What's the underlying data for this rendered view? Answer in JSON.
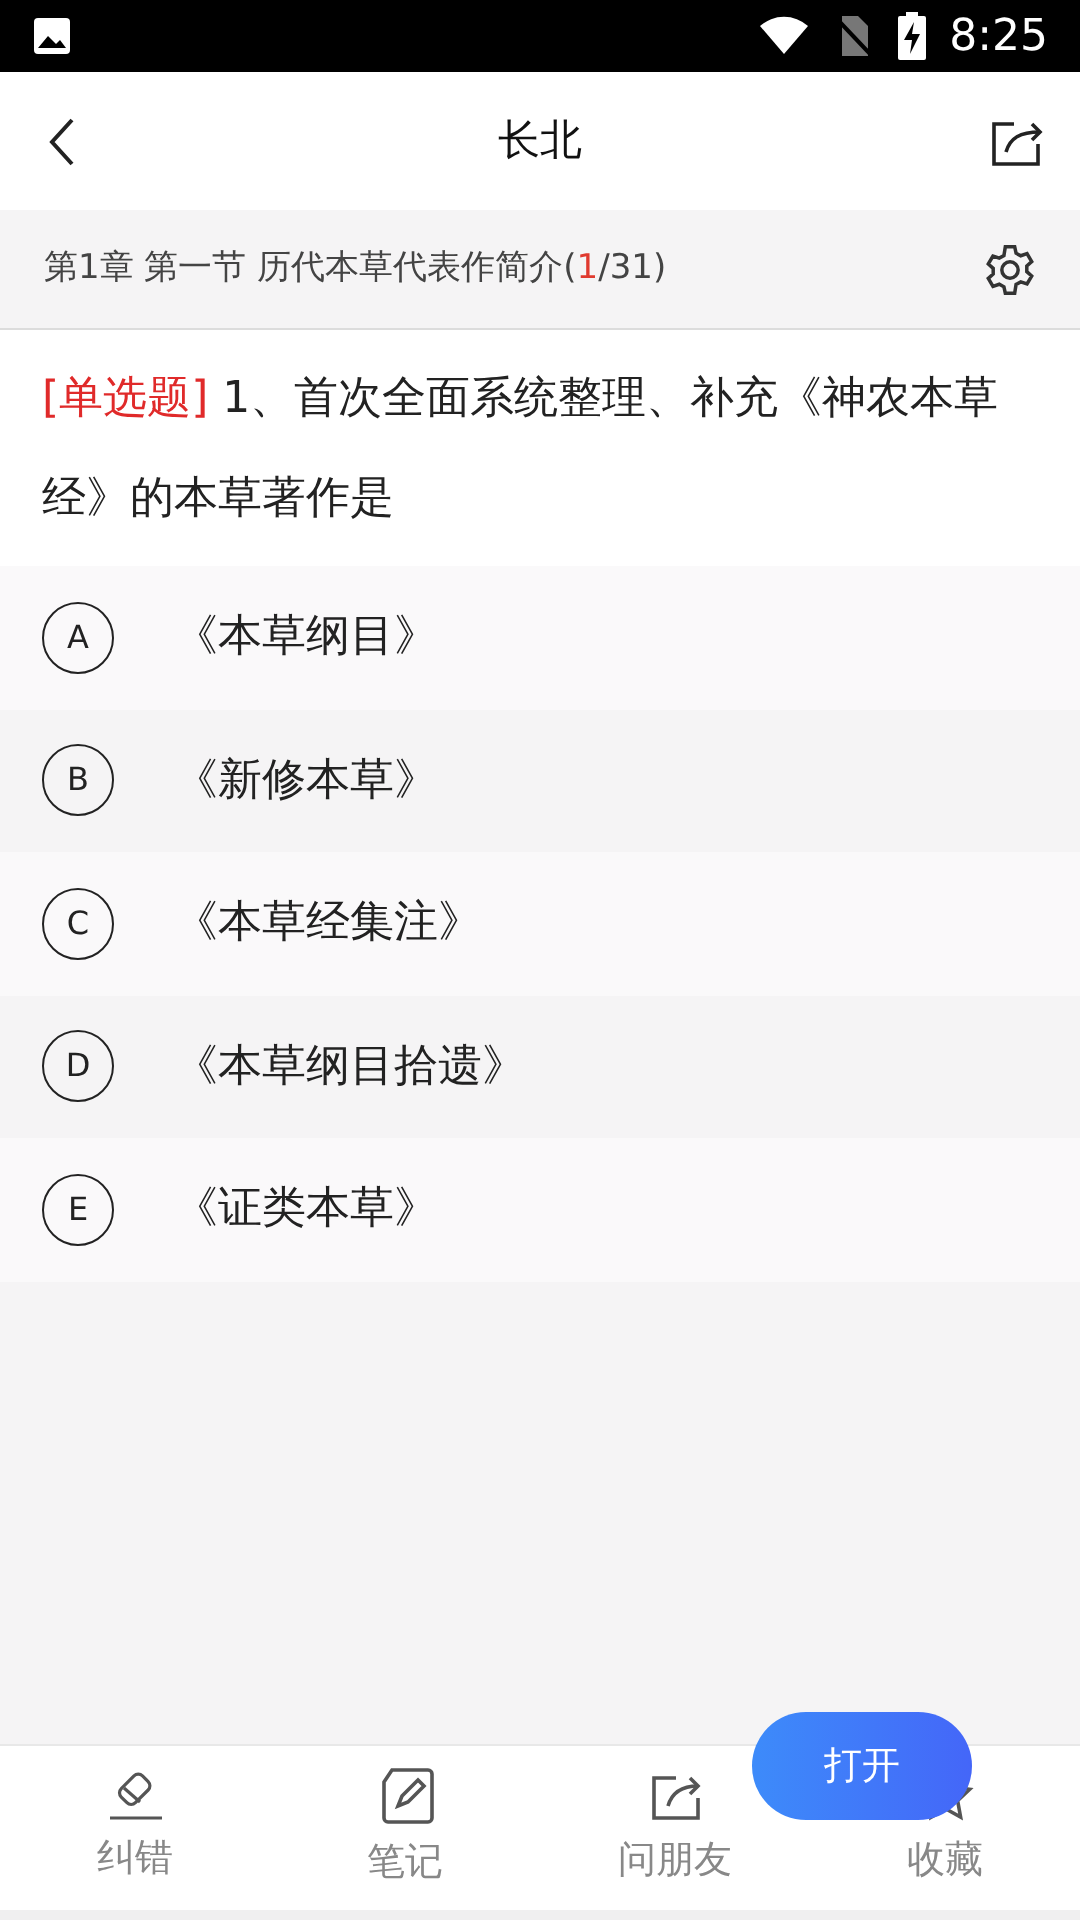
{
  "status_bar": {
    "time": "8:25"
  },
  "header": {
    "title": "长北"
  },
  "chapter": {
    "prefix": "第1章 第一节 历代本草代表作简介(",
    "current": "1",
    "suffix": "/31)"
  },
  "question": {
    "type": "[单选题]",
    "text": "1、首次全面系统整理、补充《神农本草经》的本草著作是"
  },
  "options": [
    {
      "letter": "A",
      "text": "《本草纲目》",
      "selected": false
    },
    {
      "letter": "B",
      "text": "《新修本草》",
      "selected": false
    },
    {
      "letter": "C",
      "text": "《本草经集注》",
      "selected": false
    },
    {
      "letter": "D",
      "text": "《本草纲目拾遗》",
      "selected": false
    },
    {
      "letter": "E",
      "text": "《证类本草》",
      "selected": false
    }
  ],
  "bottom_bar": [
    {
      "kind": "eraser",
      "label": "纠错"
    },
    {
      "kind": "note",
      "label": "笔记"
    },
    {
      "kind": "share",
      "label": "问朋友"
    },
    {
      "kind": "star",
      "label": "收藏"
    }
  ],
  "open_button": {
    "label": "打开"
  }
}
